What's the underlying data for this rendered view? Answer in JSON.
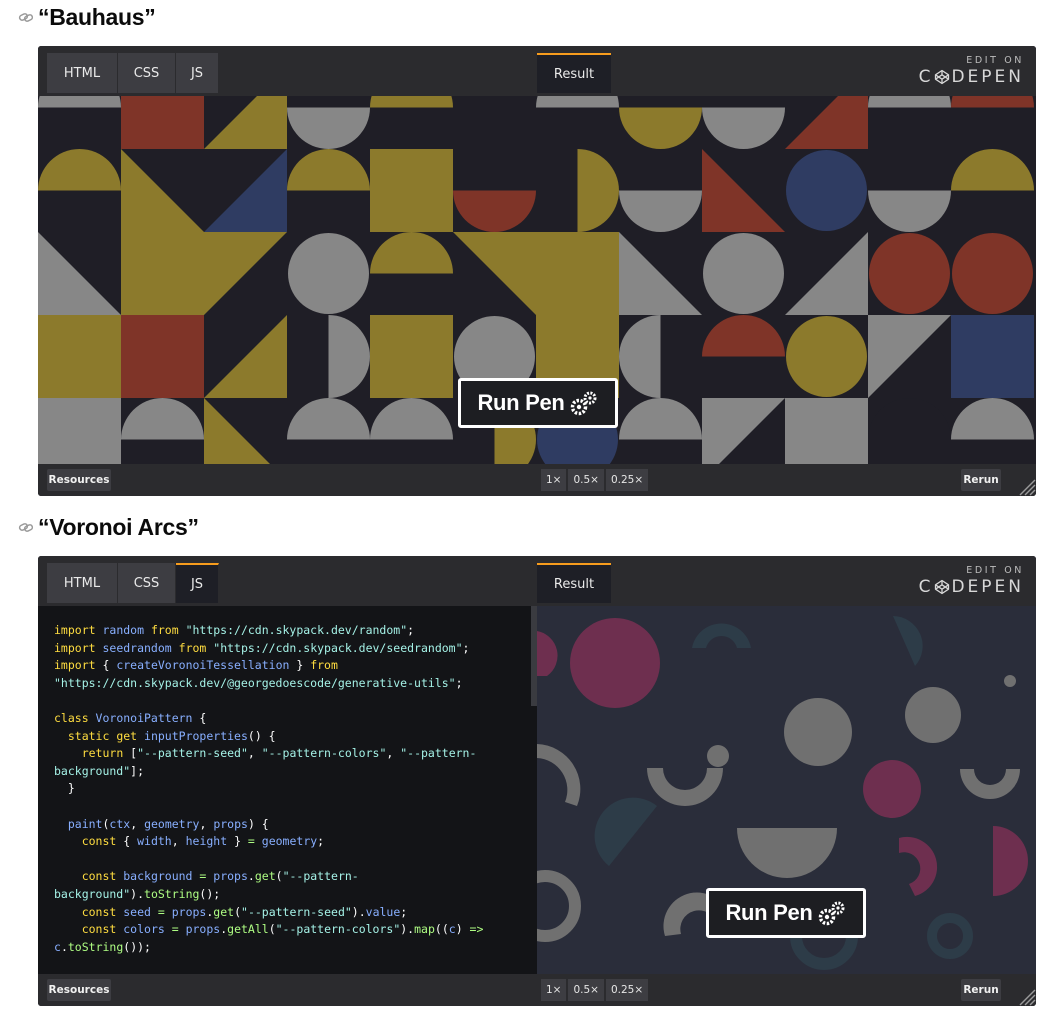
{
  "colors": {
    "pen_bg": "#1e1f26",
    "toolbar_bg": "#2b2b2e",
    "tab_bg": "#3d3d42",
    "accent_orange": "#f79c1d",
    "bauhaus_yellow": "#8c7a2c",
    "bauhaus_gray": "#878787",
    "bauhaus_red": "#7f3428",
    "bauhaus_blue": "#2f3c62",
    "voronoi_bg": "#2a2d3a",
    "voronoi_magenta": "#6e2f4f",
    "voronoi_teal": "#2d3c48",
    "voronoi_gray": "#707070"
  },
  "pens": [
    {
      "heading": "“Bauhaus”",
      "link_icon": "link-icon",
      "tabs": [
        {
          "label": "HTML",
          "active": false
        },
        {
          "label": "CSS",
          "active": false
        },
        {
          "label": "JS",
          "active": false
        }
      ],
      "result_label": "Result",
      "edit_on": "EDIT ON",
      "brand": [
        "C",
        "DEPEN"
      ],
      "run_pen_label": "Run Pen",
      "resources_label": "Resources",
      "zoom_options": [
        "1×",
        "0.5×",
        "0.25×"
      ],
      "rerun_label": "Rerun"
    },
    {
      "heading": "“Voronoi Arcs”",
      "link_icon": "link-icon",
      "tabs": [
        {
          "label": "HTML",
          "active": false
        },
        {
          "label": "CSS",
          "active": false
        },
        {
          "label": "JS",
          "active": true
        }
      ],
      "result_label": "Result",
      "edit_on": "EDIT ON",
      "brand": [
        "C",
        "DEPEN"
      ],
      "run_pen_label": "Run Pen",
      "resources_label": "Resources",
      "zoom_options": [
        "1×",
        "0.5×",
        "0.25×"
      ],
      "rerun_label": "Rerun",
      "code_lines": [
        [
          [
            "kw",
            "import "
          ],
          [
            "id",
            "random "
          ],
          [
            "kw",
            "from "
          ],
          [
            "str",
            "\"https://cdn.skypack.dev/random\""
          ],
          [
            "pl",
            ";"
          ]
        ],
        [
          [
            "kw",
            "import "
          ],
          [
            "id",
            "seedrandom "
          ],
          [
            "kw",
            "from "
          ],
          [
            "str",
            "\"https://cdn.skypack.dev/seedrandom\""
          ],
          [
            "pl",
            ";"
          ]
        ],
        [
          [
            "kw",
            "import "
          ],
          [
            "pl",
            "{ "
          ],
          [
            "id",
            "createVoronoiTessellation "
          ],
          [
            "pl",
            "} "
          ],
          [
            "kw",
            "from"
          ]
        ],
        [
          [
            "str",
            "\"https://cdn.skypack.dev/@georgedoescode/generative-utils\""
          ],
          [
            "pl",
            ";"
          ]
        ],
        [
          [
            "pl",
            ""
          ]
        ],
        [
          [
            "kw",
            "class "
          ],
          [
            "id",
            "VoronoiPattern "
          ],
          [
            "pl",
            "{"
          ]
        ],
        [
          [
            "pl",
            "  "
          ],
          [
            "kw",
            "static get "
          ],
          [
            "id",
            "inputProperties"
          ],
          [
            "pl",
            "() {"
          ]
        ],
        [
          [
            "pl",
            "    "
          ],
          [
            "kw",
            "return "
          ],
          [
            "pl",
            "["
          ],
          [
            "str",
            "\"--pattern-seed\""
          ],
          [
            "pl",
            ", "
          ],
          [
            "str",
            "\"--pattern-colors\""
          ],
          [
            "pl",
            ", "
          ],
          [
            "str",
            "\"--pattern-"
          ]
        ],
        [
          [
            "str",
            "background\""
          ],
          [
            "pl",
            "];"
          ]
        ],
        [
          [
            "pl",
            "  }"
          ]
        ],
        [
          [
            "pl",
            ""
          ]
        ],
        [
          [
            "pl",
            "  "
          ],
          [
            "id",
            "paint"
          ],
          [
            "pl",
            "("
          ],
          [
            "id",
            "ctx"
          ],
          [
            "pl",
            ", "
          ],
          [
            "id",
            "geometry"
          ],
          [
            "pl",
            ", "
          ],
          [
            "id",
            "props"
          ],
          [
            "pl",
            ") {"
          ]
        ],
        [
          [
            "pl",
            "    "
          ],
          [
            "kw",
            "const "
          ],
          [
            "pl",
            "{ "
          ],
          [
            "id",
            "width"
          ],
          [
            "pl",
            ", "
          ],
          [
            "id",
            "height "
          ],
          [
            "pl",
            "} "
          ],
          [
            "fn",
            "= "
          ],
          [
            "id",
            "geometry"
          ],
          [
            "pl",
            ";"
          ]
        ],
        [
          [
            "pl",
            ""
          ]
        ],
        [
          [
            "pl",
            "    "
          ],
          [
            "kw",
            "const "
          ],
          [
            "id",
            "background "
          ],
          [
            "fn",
            "= "
          ],
          [
            "id",
            "props"
          ],
          [
            "pl",
            "."
          ],
          [
            "fn",
            "get"
          ],
          [
            "pl",
            "("
          ],
          [
            "str",
            "\"--pattern-"
          ]
        ],
        [
          [
            "str",
            "background\""
          ],
          [
            "pl",
            ")."
          ],
          [
            "fn",
            "toString"
          ],
          [
            "pl",
            "();"
          ]
        ],
        [
          [
            "pl",
            "    "
          ],
          [
            "kw",
            "const "
          ],
          [
            "id",
            "seed "
          ],
          [
            "fn",
            "= "
          ],
          [
            "id",
            "props"
          ],
          [
            "pl",
            "."
          ],
          [
            "fn",
            "get"
          ],
          [
            "pl",
            "("
          ],
          [
            "str",
            "\"--pattern-seed\""
          ],
          [
            "pl",
            ")."
          ],
          [
            "id",
            "value"
          ],
          [
            "pl",
            ";"
          ]
        ],
        [
          [
            "pl",
            "    "
          ],
          [
            "kw",
            "const "
          ],
          [
            "id",
            "colors "
          ],
          [
            "fn",
            "= "
          ],
          [
            "id",
            "props"
          ],
          [
            "pl",
            "."
          ],
          [
            "fn",
            "getAll"
          ],
          [
            "pl",
            "("
          ],
          [
            "str",
            "\"--pattern-colors\""
          ],
          [
            "pl",
            ")."
          ],
          [
            "fn",
            "map"
          ],
          [
            "pl",
            "(("
          ],
          [
            "id",
            "c"
          ],
          [
            "pl",
            ") "
          ],
          [
            "fn",
            "=>"
          ]
        ],
        [
          [
            "id",
            "c"
          ],
          [
            "pl",
            "."
          ],
          [
            "fn",
            "toString"
          ],
          [
            "pl",
            "());"
          ]
        ]
      ]
    }
  ]
}
